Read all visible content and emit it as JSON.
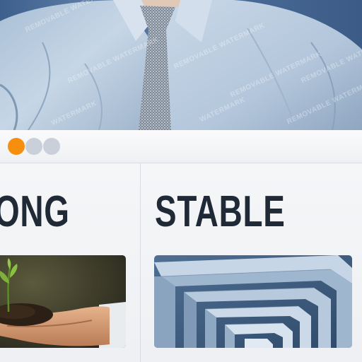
{
  "hero": {
    "watermark_text": "REMOVABLE WATERMARK",
    "watermark_short": "WATERMARK"
  },
  "slider": {
    "dots": [
      "active",
      "inactive",
      "inactive"
    ],
    "active_color": "#f68f0e",
    "inactive_color": "#c9d0da"
  },
  "columns": [
    {
      "title": "ONG",
      "image_name": "seedling-in-hands-image"
    },
    {
      "title": "STABLE",
      "image_name": "maze-image"
    }
  ],
  "colors": {
    "heading": "#1f2a36",
    "background": "#f3f4f6"
  }
}
